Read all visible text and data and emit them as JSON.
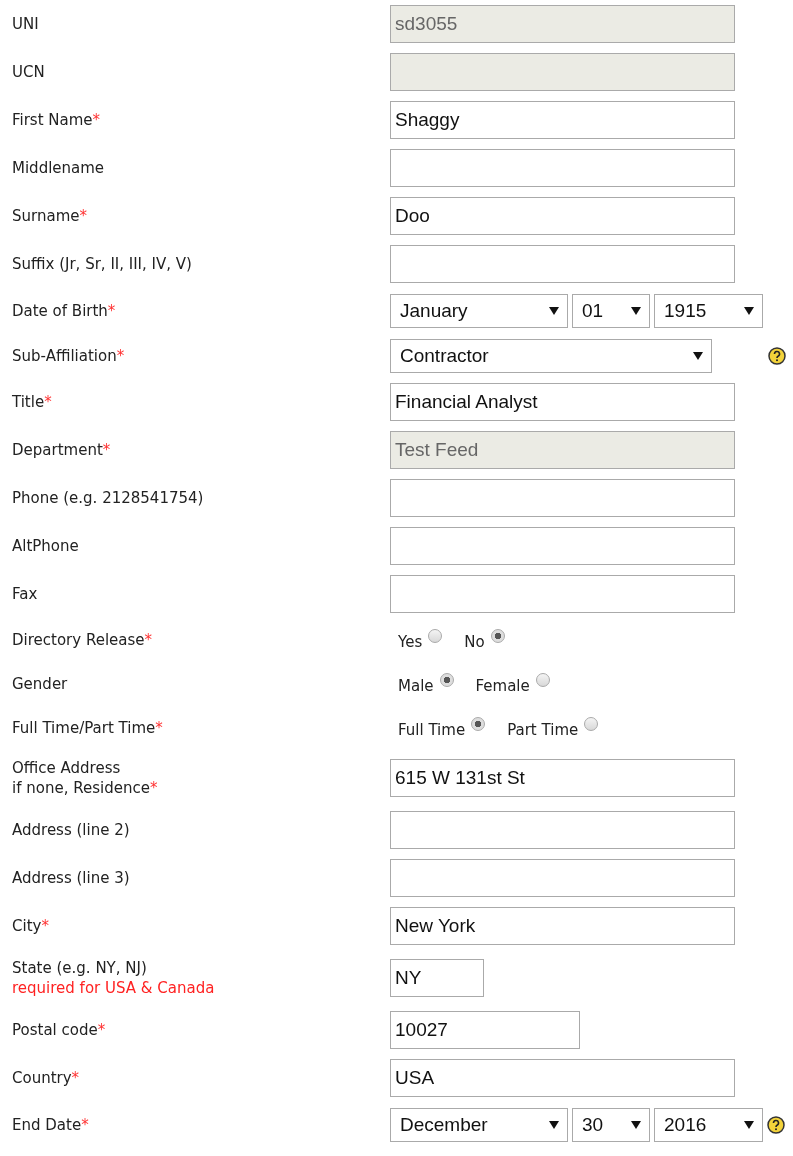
{
  "rows": [
    {
      "kind": "text",
      "label": "UNI",
      "value": "sd3055",
      "disabled": true
    },
    {
      "kind": "text",
      "label": "UCN",
      "disabled": true
    },
    {
      "kind": "text",
      "label": "First Name",
      "mark": "*",
      "value": "Shaggy",
      "disabled": false
    },
    {
      "kind": "text",
      "label": "Middlename",
      "disabled": false
    },
    {
      "kind": "text",
      "label": "Surname",
      "mark": "*",
      "value": "Doo",
      "disabled": false
    },
    {
      "kind": "text",
      "label": "Suffix (Jr, Sr, II, III, IV, V)",
      "disabled": false
    },
    {
      "kind": "date",
      "label": "Date of Birth",
      "mark": "*",
      "month": "January",
      "day": "01",
      "year": "1915"
    },
    {
      "kind": "select",
      "label": "Sub-Affiliation",
      "mark": "*",
      "value": "Contractor",
      "help": true
    },
    {
      "kind": "text",
      "label": "Title",
      "mark": "*",
      "value": "Financial Analyst",
      "disabled": false
    },
    {
      "kind": "text",
      "label": "Department",
      "mark": "*",
      "value": "Test Feed",
      "disabled": true
    },
    {
      "kind": "text",
      "label": "Phone (e.g. 2128541754)",
      "disabled": false
    },
    {
      "kind": "text",
      "label": "AltPhone",
      "disabled": false
    },
    {
      "kind": "text",
      "label": "Fax",
      "disabled": false
    },
    {
      "kind": "radio",
      "label": "Directory Release",
      "mark": "*",
      "options": [
        {
          "label": "Yes",
          "selected": false
        },
        {
          "label": "No",
          "selected": true
        }
      ]
    },
    {
      "kind": "radio",
      "label": "Gender",
      "options": [
        {
          "label": "Male",
          "selected": true
        },
        {
          "label": "Female",
          "selected": false
        }
      ]
    },
    {
      "kind": "radio",
      "label": "Full Time/Part Time",
      "mark": "*",
      "options": [
        {
          "label": "Full Time",
          "selected": true
        },
        {
          "label": "Part Time",
          "selected": false
        }
      ]
    },
    {
      "kind": "text",
      "label": "Office Address",
      "label_2": "if none, Residence",
      "mark": "*",
      "value": "615 W 131st St",
      "disabled": false
    },
    {
      "kind": "text",
      "label": "Address (line 2)",
      "disabled": false
    },
    {
      "kind": "text",
      "label": "Address (line 3)",
      "disabled": false
    },
    {
      "kind": "text",
      "label": "City",
      "mark": "*",
      "value": "New York",
      "disabled": false
    },
    {
      "kind": "tiny",
      "label": "State (e.g. NY, NJ)",
      "note": "required for USA & Canada",
      "value": "NY",
      "disabled": false
    },
    {
      "kind": "short",
      "label": "Postal code",
      "mark": "*",
      "value": "10027",
      "disabled": false
    },
    {
      "kind": "text",
      "label": "Country",
      "mark": "*",
      "value": "USA",
      "disabled": false
    },
    {
      "kind": "date",
      "label": "End Date",
      "mark": "*",
      "month": "December",
      "day": "30",
      "year": "2016",
      "help": true
    }
  ]
}
